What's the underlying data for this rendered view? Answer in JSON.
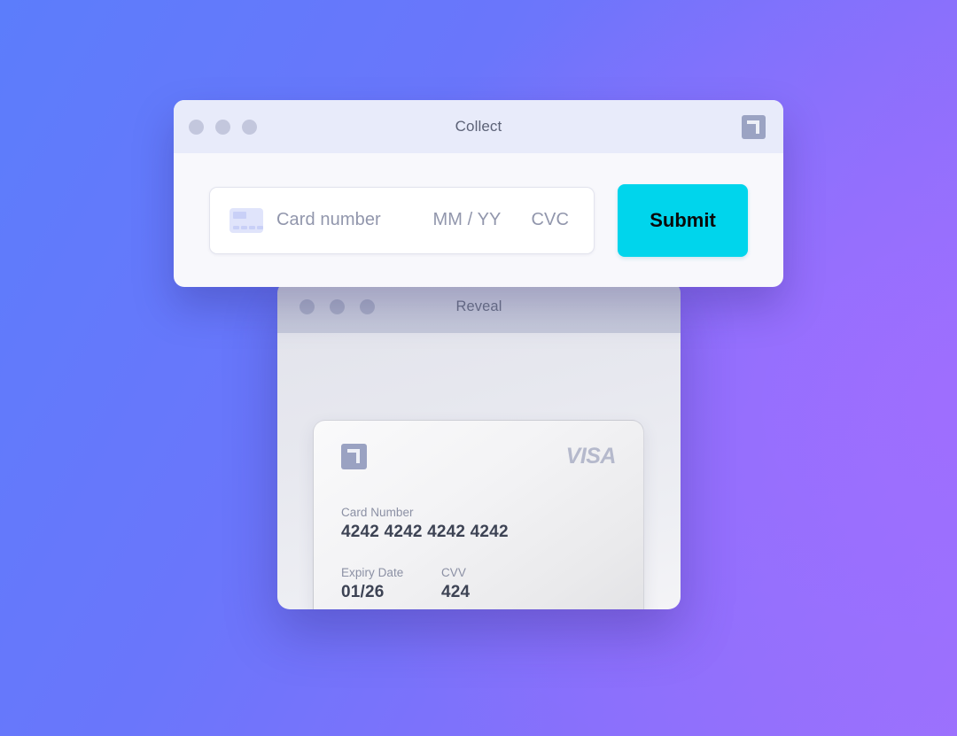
{
  "background": {
    "gradient_from": "#5c7dfb",
    "gradient_to": "#9a72fc"
  },
  "collect_window": {
    "title": "Collect",
    "badge_icon": "brand-badge-icon",
    "traffic_lights": [
      "close-dot",
      "minimize-dot",
      "maximize-dot"
    ],
    "card_input": {
      "brand_icon": "credit-card-icon",
      "card_number_placeholder": "Card number",
      "expiry_placeholder": "MM / YY",
      "cvc_placeholder": "CVC",
      "card_number_value": "",
      "expiry_value": "",
      "cvc_value": ""
    },
    "submit_label": "Submit",
    "submit_color": "#00d5ec"
  },
  "reveal_window": {
    "title": "Reveal",
    "traffic_lights": [
      "close-dot",
      "minimize-dot",
      "maximize-dot"
    ],
    "card": {
      "badge_icon": "brand-badge-icon",
      "network_logo": "VISA",
      "card_number_label": "Card Number",
      "card_number_value": "4242 4242 4242 4242",
      "expiry_label": "Expiry Date",
      "expiry_value": "01/26",
      "cvv_label": "CVV",
      "cvv_value": "424"
    }
  }
}
